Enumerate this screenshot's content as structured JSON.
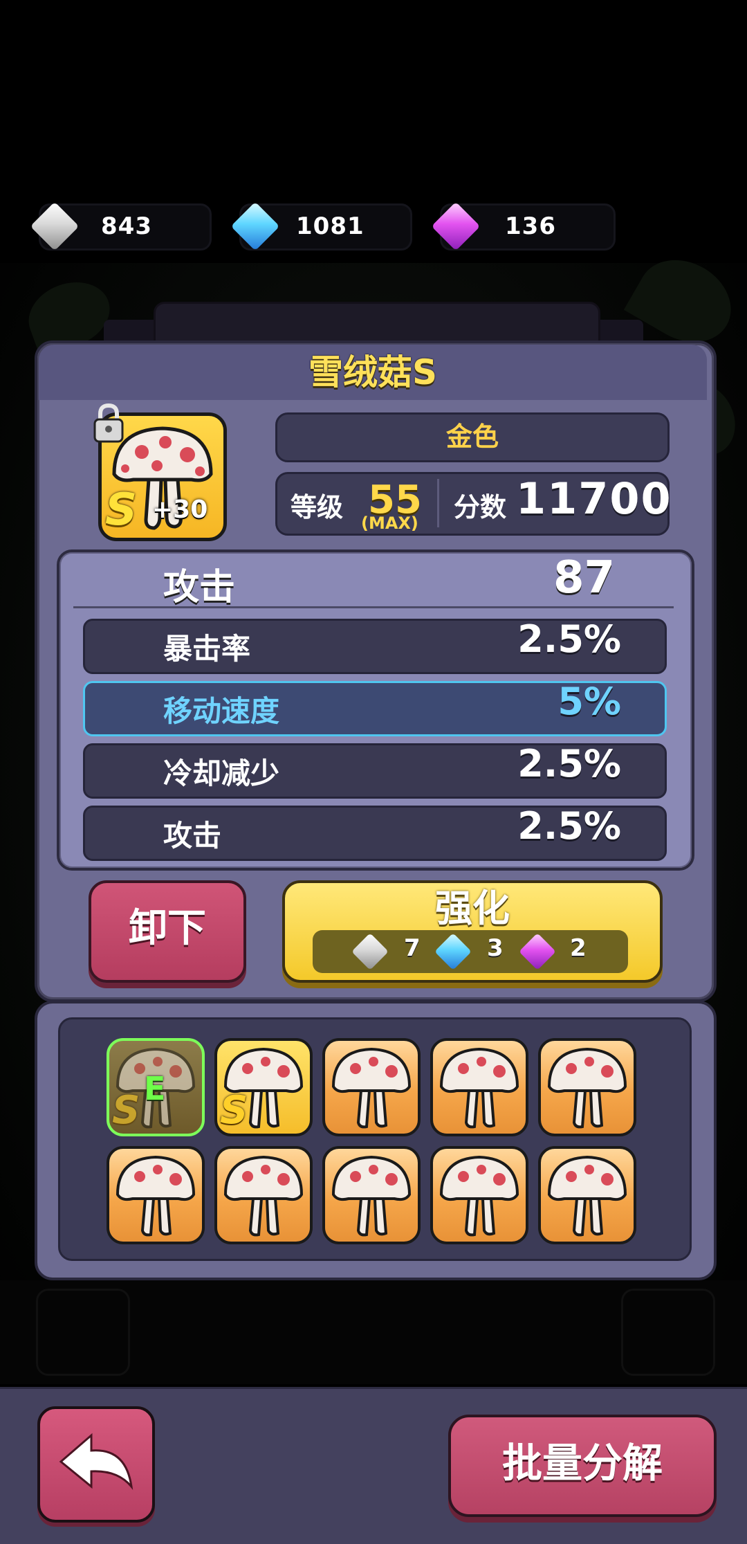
{
  "currencies": [
    {
      "icon": "silver-gem-icon",
      "value": "843",
      "color": "#d9d9d9"
    },
    {
      "icon": "blue-gem-icon",
      "value": "1081",
      "color": "#5fd6ff"
    },
    {
      "icon": "purple-gem-icon",
      "value": "136",
      "color": "#e353f0"
    }
  ],
  "item": {
    "name": "雪绒菇S",
    "rarity": "金色",
    "enhance_level": "+30",
    "grade_letter": "S",
    "level_label": "等级",
    "level_value": "55",
    "level_max": "(MAX)",
    "score_label": "分数",
    "score_value": "11700",
    "locked": true
  },
  "stats": {
    "main": {
      "label": "攻击",
      "value": "87"
    },
    "sub": [
      {
        "label": "暴击率",
        "value": "2.5%",
        "highlighted": false
      },
      {
        "label": "移动速度",
        "value": "5%",
        "highlighted": true
      },
      {
        "label": "冷却减少",
        "value": "2.5%",
        "highlighted": false
      },
      {
        "label": "攻击",
        "value": "2.5%",
        "highlighted": false
      }
    ]
  },
  "actions": {
    "unequip_label": "卸下",
    "upgrade_label": "强化",
    "upgrade_cost": [
      {
        "icon": "silver-gem-icon",
        "amount": "7"
      },
      {
        "icon": "blue-gem-icon",
        "amount": "3"
      },
      {
        "icon": "purple-gem-icon",
        "amount": "2"
      }
    ]
  },
  "inventory": {
    "slots": [
      {
        "badge": "E",
        "grade": "S",
        "equipped": true
      },
      {
        "badge": "",
        "grade": "S",
        "equipped": false
      },
      {
        "badge": "",
        "grade": "",
        "equipped": false
      },
      {
        "badge": "",
        "grade": "",
        "equipped": false
      },
      {
        "badge": "",
        "grade": "",
        "equipped": false
      },
      {
        "badge": "",
        "grade": "",
        "equipped": false
      },
      {
        "badge": "",
        "grade": "",
        "equipped": false
      },
      {
        "badge": "",
        "grade": "",
        "equipped": false
      },
      {
        "badge": "",
        "grade": "",
        "equipped": false
      },
      {
        "badge": "",
        "grade": "",
        "equipped": false
      }
    ]
  },
  "footer": {
    "back_icon": "back-arrow-icon",
    "decompose_label": "批量分解"
  },
  "colors": {
    "panel": "#6d6b92",
    "gold_text": "#ffd84a",
    "highlight_blue": "#6fd3ff",
    "pink_button": "#c24a6c",
    "yellow_button": "#f8d74a"
  }
}
